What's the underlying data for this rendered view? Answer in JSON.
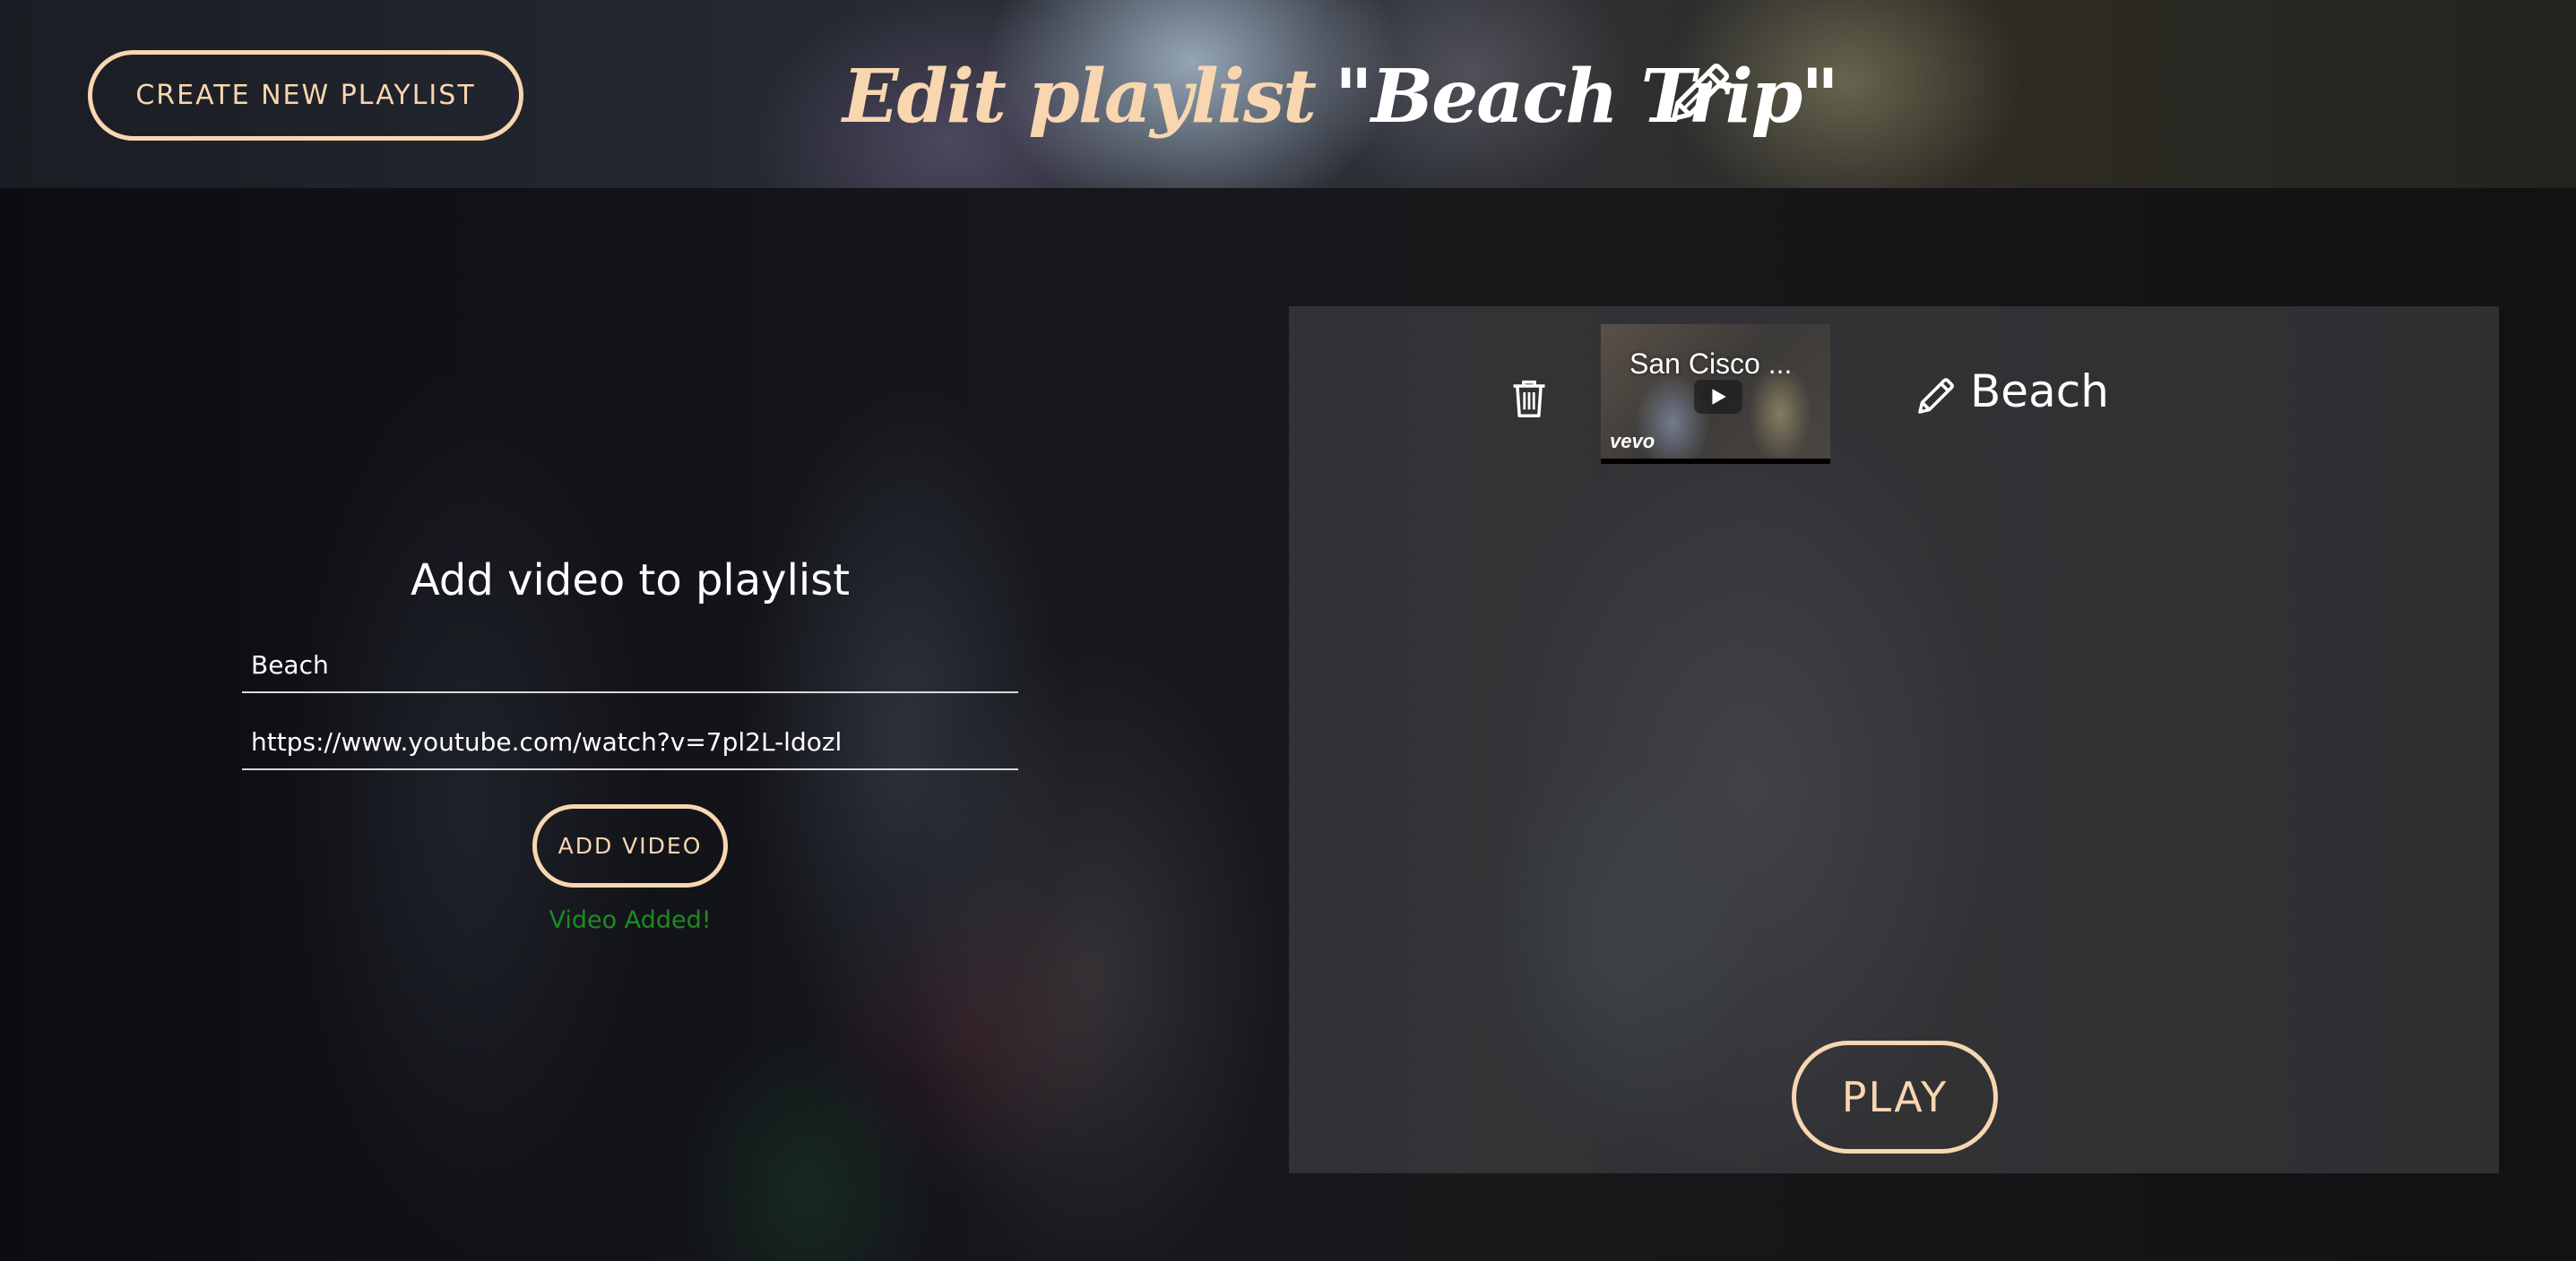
{
  "header": {
    "create_button_label": "CREATE NEW PLAYLIST",
    "title_prefix": "Edit playlist",
    "title_quote_open": "\"",
    "title_name": "Beach Trip",
    "title_quote_close": "\"",
    "edit_icon": "pencil-icon"
  },
  "add_video": {
    "heading": "Add video to playlist",
    "title_value": "Beach",
    "url_value": "https://www.youtube.com/watch?v=7pl2L-ldozl",
    "button_label": "ADD VIDEO",
    "status_message": "Video Added!"
  },
  "playlist": {
    "videos": [
      {
        "thumbnail_title": "San Cisco ...",
        "thumbnail_logo": "vevo",
        "name": "Beach",
        "delete_icon": "trash-icon",
        "edit_icon": "pencil-icon"
      }
    ],
    "play_label": "PLAY"
  },
  "colors": {
    "accent": "#f8d6b0",
    "success": "#1f8a23",
    "text": "#ffffff"
  }
}
